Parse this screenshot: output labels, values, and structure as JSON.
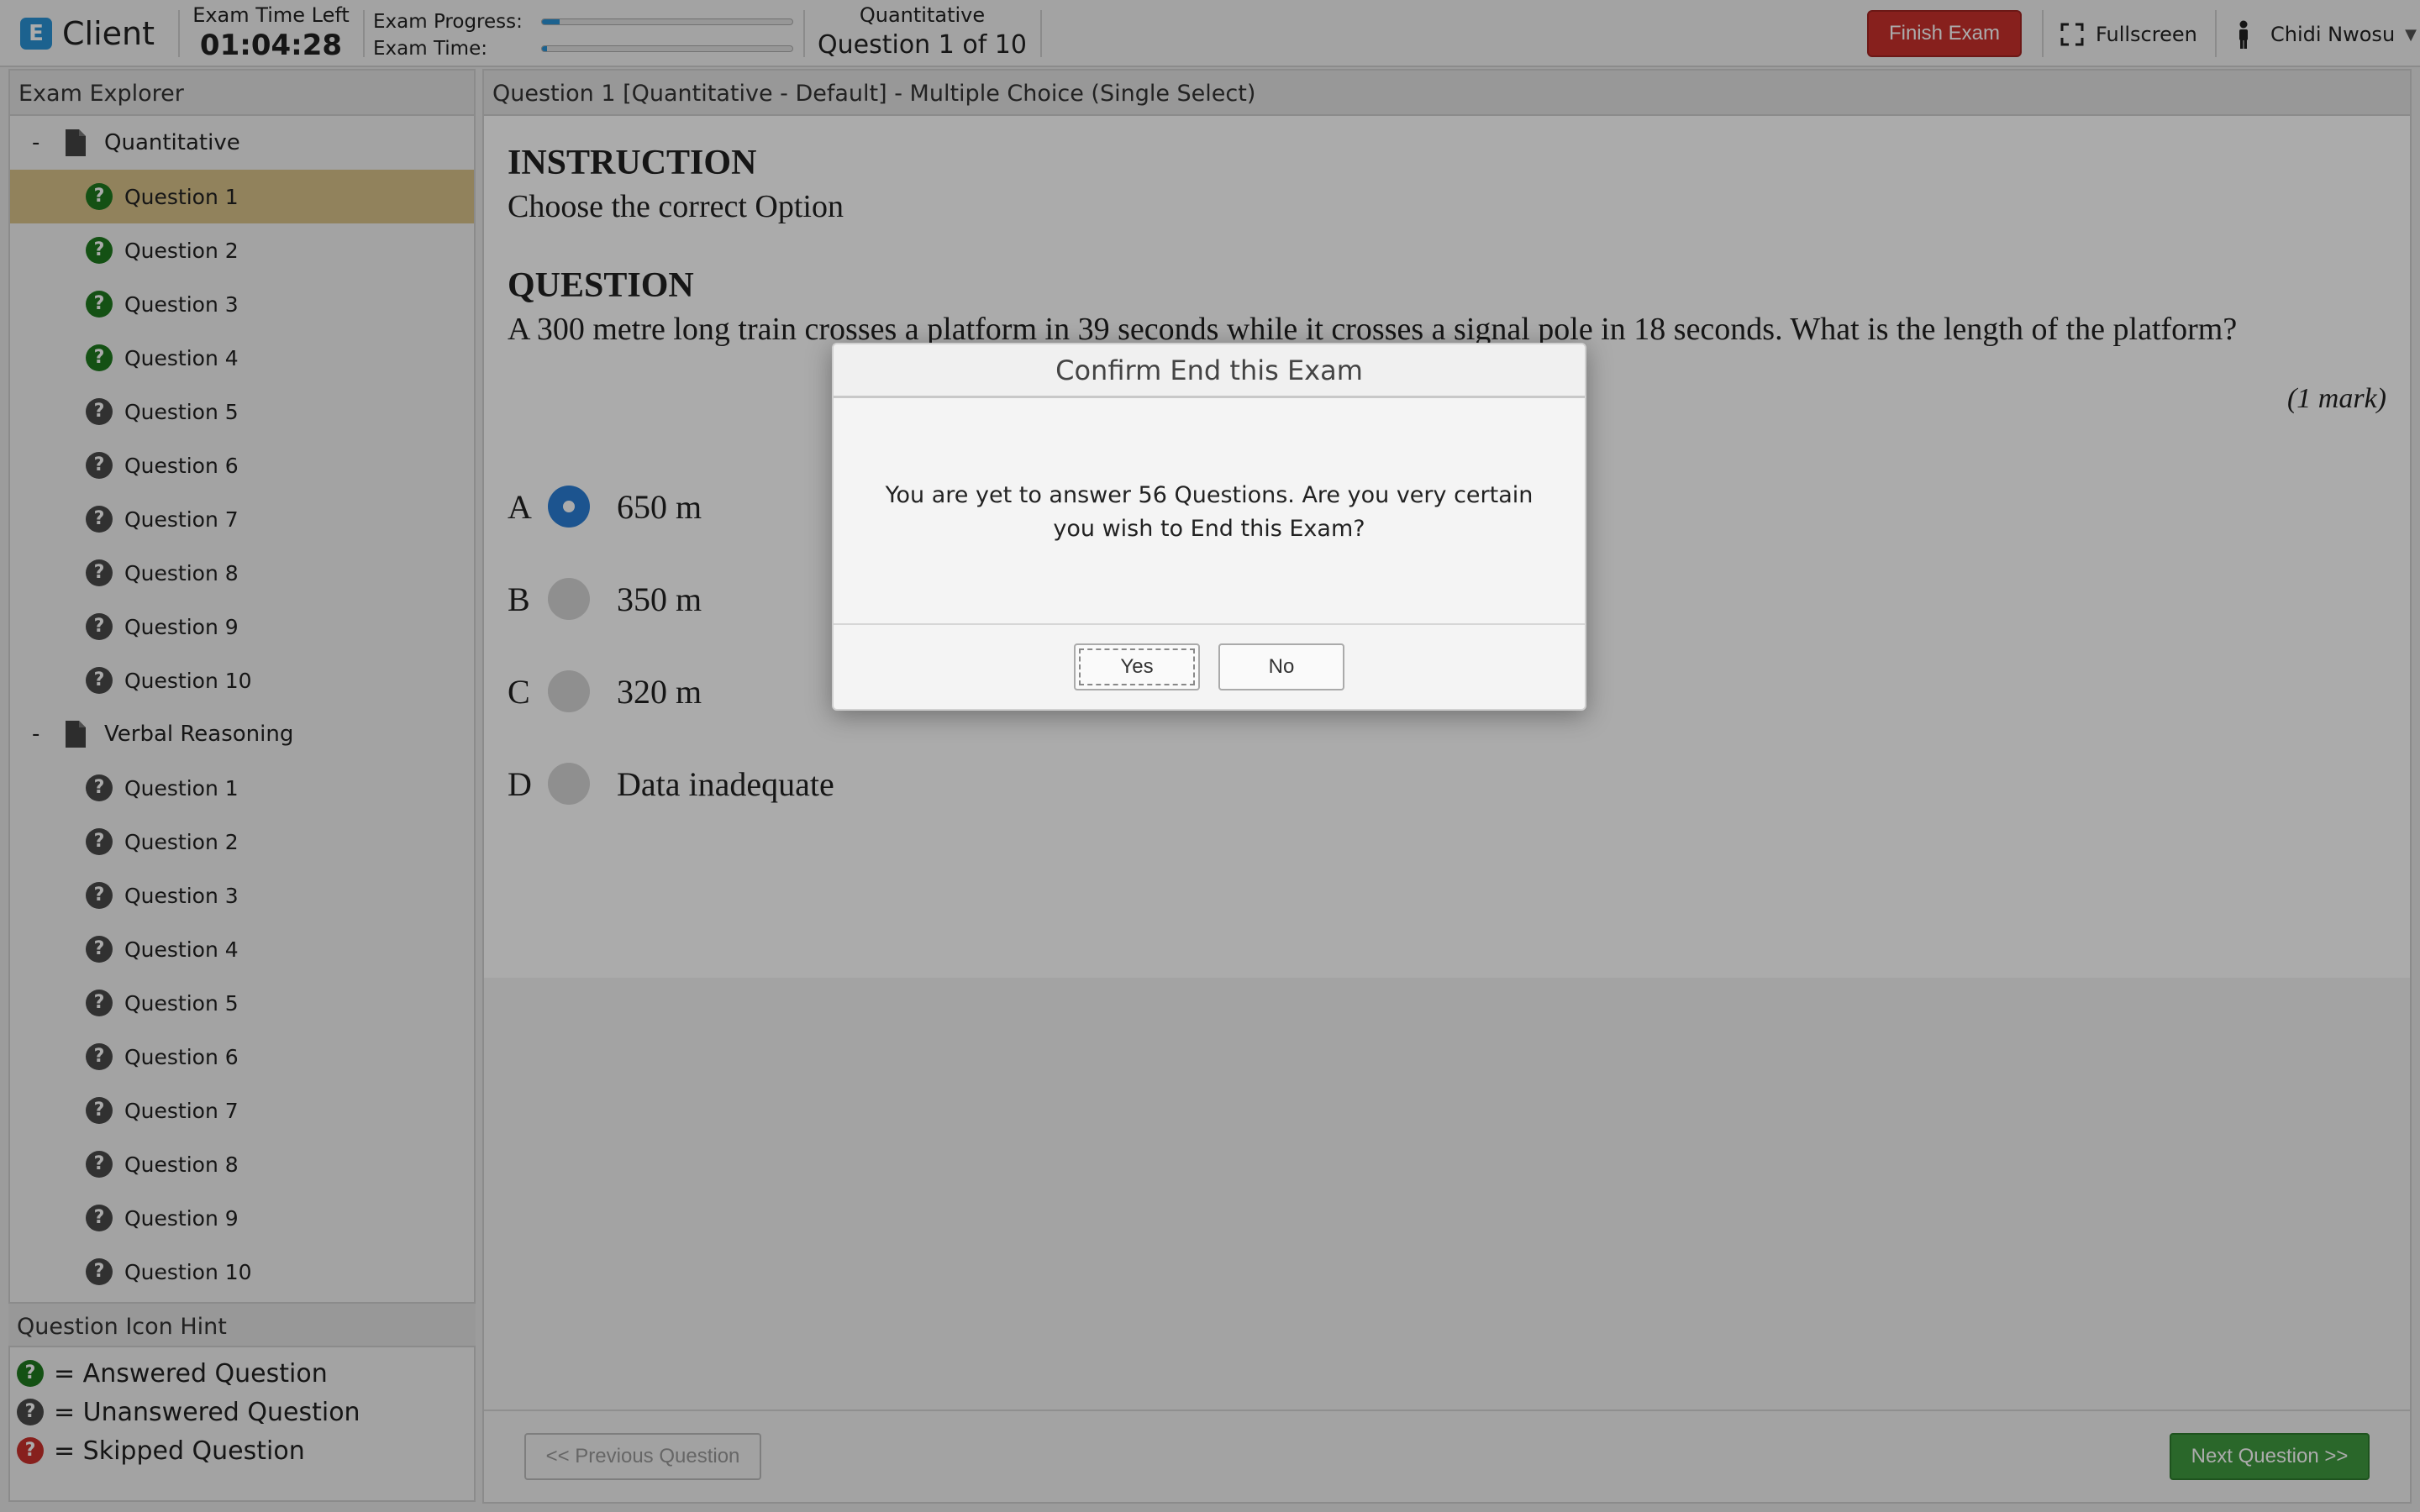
{
  "app": {
    "name": "Client"
  },
  "header": {
    "time_left_label": "Exam Time Left",
    "time_left_value": "01:04:28",
    "progress_label": "Exam Progress:",
    "exam_time_label": "Exam Time:",
    "progress_fraction": 0.07,
    "exam_time_fraction": 0.02,
    "section_name": "Quantitative",
    "question_of": "Question 1 of 10",
    "finish_label": "Finish Exam",
    "fullscreen_label": "Fullscreen",
    "user_name": "Chidi Nwosu",
    "caret": "▼"
  },
  "explorer": {
    "title": "Exam Explorer",
    "sections": [
      {
        "collapse": "-",
        "name": "Quantitative",
        "items": [
          {
            "label": "Question 1",
            "status": "answered",
            "icon": "?"
          },
          {
            "label": "Question 2",
            "status": "answered",
            "icon": "?"
          },
          {
            "label": "Question 3",
            "status": "answered",
            "icon": "?"
          },
          {
            "label": "Question 4",
            "status": "answered",
            "icon": "?"
          },
          {
            "label": "Question 5",
            "status": "unanswered",
            "icon": "?"
          },
          {
            "label": "Question 6",
            "status": "unanswered",
            "icon": "?"
          },
          {
            "label": "Question 7",
            "status": "unanswered",
            "icon": "?"
          },
          {
            "label": "Question 8",
            "status": "unanswered",
            "icon": "?"
          },
          {
            "label": "Question 9",
            "status": "unanswered",
            "icon": "?"
          },
          {
            "label": "Question 10",
            "status": "unanswered",
            "icon": "?"
          }
        ]
      },
      {
        "collapse": "-",
        "name": "Verbal Reasoning",
        "items": [
          {
            "label": "Question 1",
            "status": "unanswered",
            "icon": "?"
          },
          {
            "label": "Question 2",
            "status": "unanswered",
            "icon": "?"
          },
          {
            "label": "Question 3",
            "status": "unanswered",
            "icon": "?"
          },
          {
            "label": "Question 4",
            "status": "unanswered",
            "icon": "?"
          },
          {
            "label": "Question 5",
            "status": "unanswered",
            "icon": "?"
          },
          {
            "label": "Question 6",
            "status": "unanswered",
            "icon": "?"
          },
          {
            "label": "Question 7",
            "status": "unanswered",
            "icon": "?"
          },
          {
            "label": "Question 8",
            "status": "unanswered",
            "icon": "?"
          },
          {
            "label": "Question 9",
            "status": "unanswered",
            "icon": "?"
          },
          {
            "label": "Question 10",
            "status": "unanswered",
            "icon": "?"
          }
        ]
      }
    ]
  },
  "hints": {
    "title": "Question Icon Hint",
    "items": [
      {
        "icon": "?",
        "text": "= Answered Question",
        "status": "answered"
      },
      {
        "icon": "?",
        "text": "= Unanswered Question",
        "status": "unanswered"
      },
      {
        "icon": "?",
        "text": "= Skipped Question",
        "status": "skipped"
      }
    ]
  },
  "question": {
    "header": "Question 1 [Quantitative - Default] - Multiple Choice (Single Select)",
    "instruction_title": "INSTRUCTION",
    "instruction_text": "Choose the correct Option",
    "question_title": "QUESTION",
    "question_text": "A 300 metre long train crosses a platform in 39 seconds while it crosses a signal pole in 18 seconds. What is the length of the platform?",
    "mark": "(1 mark)",
    "options": [
      {
        "letter": "A",
        "text": "650 m",
        "selected": true
      },
      {
        "letter": "B",
        "text": "350 m",
        "selected": false
      },
      {
        "letter": "C",
        "text": "320 m",
        "selected": false
      },
      {
        "letter": "D",
        "text": "Data inadequate",
        "selected": false
      }
    ]
  },
  "nav": {
    "prev_label": "<< Previous Question",
    "next_label": "Next Question >>"
  },
  "modal": {
    "title": "Confirm End this Exam",
    "message": "You are yet to answer 56 Questions. Are you very certain you wish to End this Exam?",
    "yes_label": "Yes",
    "no_label": "No"
  },
  "colors": {
    "accent": "#2a93d5",
    "answered": "#1e7a1e",
    "unanswered": "#4a4a4a",
    "skipped": "#c9302c",
    "finish": "#c9302c",
    "next": "#3f9a3f",
    "active_row": "#d9c28a"
  }
}
